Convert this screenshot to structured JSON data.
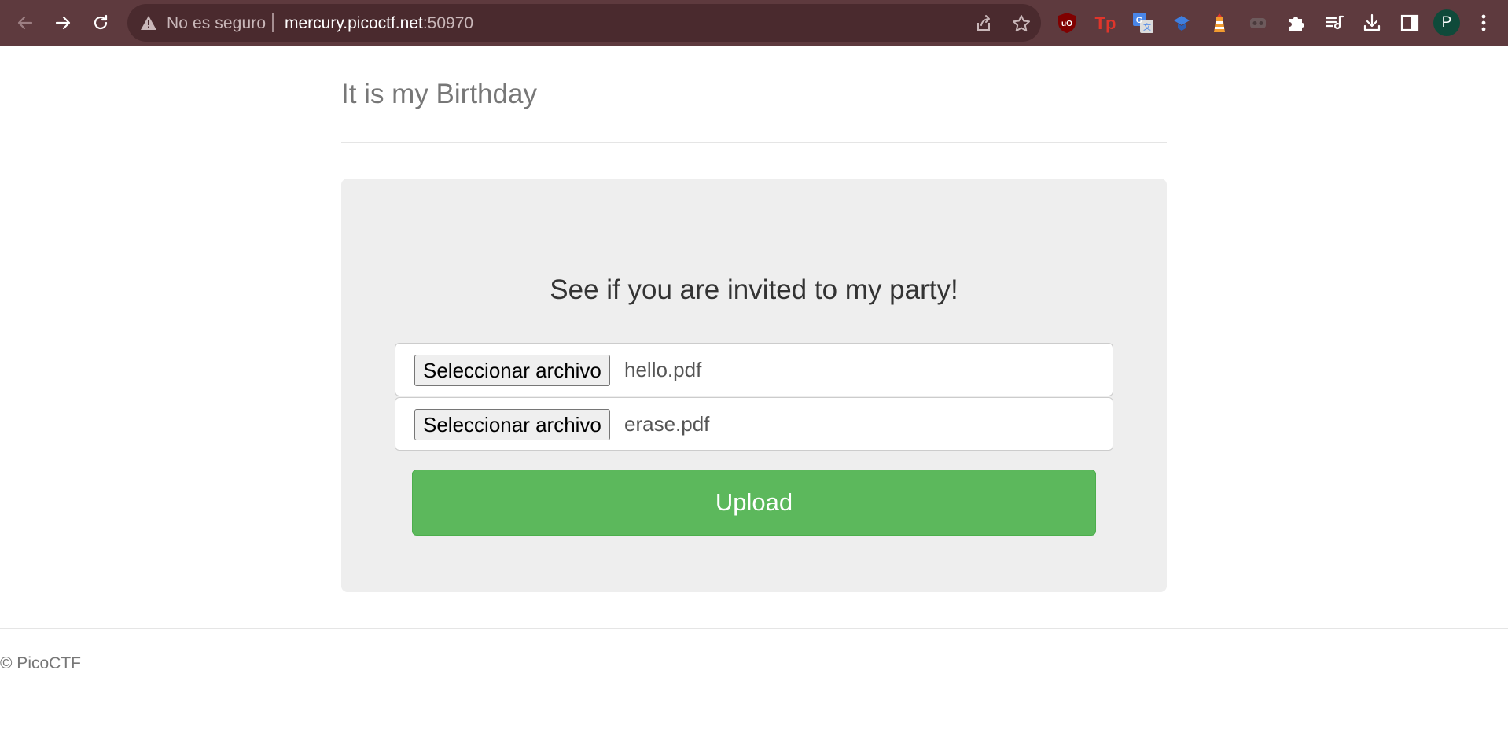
{
  "browser": {
    "security_label": "No es seguro",
    "url_host": "mercury.picoctf.net",
    "url_port": ":50970",
    "profile_initial": "P",
    "icons": {
      "back": "arrow-left-icon",
      "forward": "arrow-right-icon",
      "reload": "reload-icon",
      "warning": "warning-triangle-icon",
      "share": "share-icon",
      "bookmark": "star-icon",
      "extensions": [
        "ublock-icon",
        "tp-extension-icon",
        "google-translate-icon",
        "bluebird-extension-icon",
        "lighthouse-icon",
        "gray-extension-icon",
        "puzzle-icon"
      ],
      "toolbar": [
        "reading-list-icon",
        "download-icon",
        "side-panel-icon",
        "kebab-menu-icon"
      ]
    },
    "colors": {
      "toolbar_bg": "#5e3a3e",
      "omnibox_bg": "#4a2a2e",
      "avatar_bg": "#0f4a3a"
    }
  },
  "page": {
    "title": "It is my Birthday",
    "heading": "See if you are invited to my party!",
    "file_inputs": [
      {
        "button_label": "Seleccionar archivo",
        "file_name": "hello.pdf"
      },
      {
        "button_label": "Seleccionar archivo",
        "file_name": "erase.pdf"
      }
    ],
    "upload_label": "Upload",
    "footer": "© PicoCTF",
    "colors": {
      "upload_button": "#5cb85c",
      "panel_bg": "#eeeeee"
    }
  }
}
